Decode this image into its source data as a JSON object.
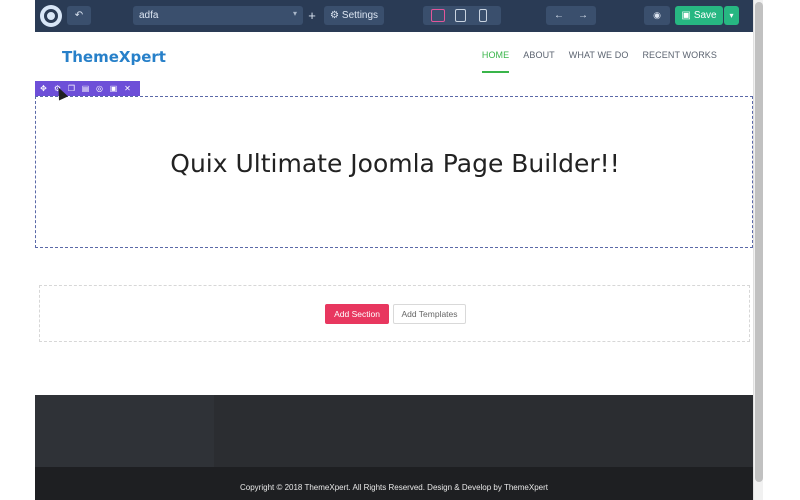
{
  "toolbar": {
    "page_name": "adfa",
    "settings_label": "Settings",
    "save_label": "Save",
    "add_symbol": "+",
    "undo_symbol": "↶",
    "nav_back": "←",
    "nav_forward": "→",
    "preview_symbol": "👁",
    "caret": "▾",
    "colors": {
      "bar": "#2a3b55",
      "save": "#27b782",
      "active_device": "#e2569a"
    }
  },
  "site": {
    "logo": "ThemeXpert",
    "nav": [
      "HOME",
      "ABOUT",
      "WHAT WE DO",
      "RECENT WORKS"
    ],
    "active_nav": "HOME",
    "colors": {
      "logo": "#2780c9",
      "active_nav": "#39b54a"
    }
  },
  "hero": {
    "title": "Quix Ultimate Joomla Page Builder!!"
  },
  "section_tools": [
    "move-icon",
    "settings-icon",
    "copy-icon",
    "paste-icon",
    "hide-icon",
    "save-icon",
    "delete-icon"
  ],
  "add_zone": {
    "add_section": "Add Section",
    "add_templates": "Add Templates",
    "colors": {
      "add_section": "#e8375f"
    }
  },
  "footer": {
    "copyright": "Copyright © 2018 ThemeXpert. All Rights Reserved. Design & Develop by ThemeXpert"
  }
}
